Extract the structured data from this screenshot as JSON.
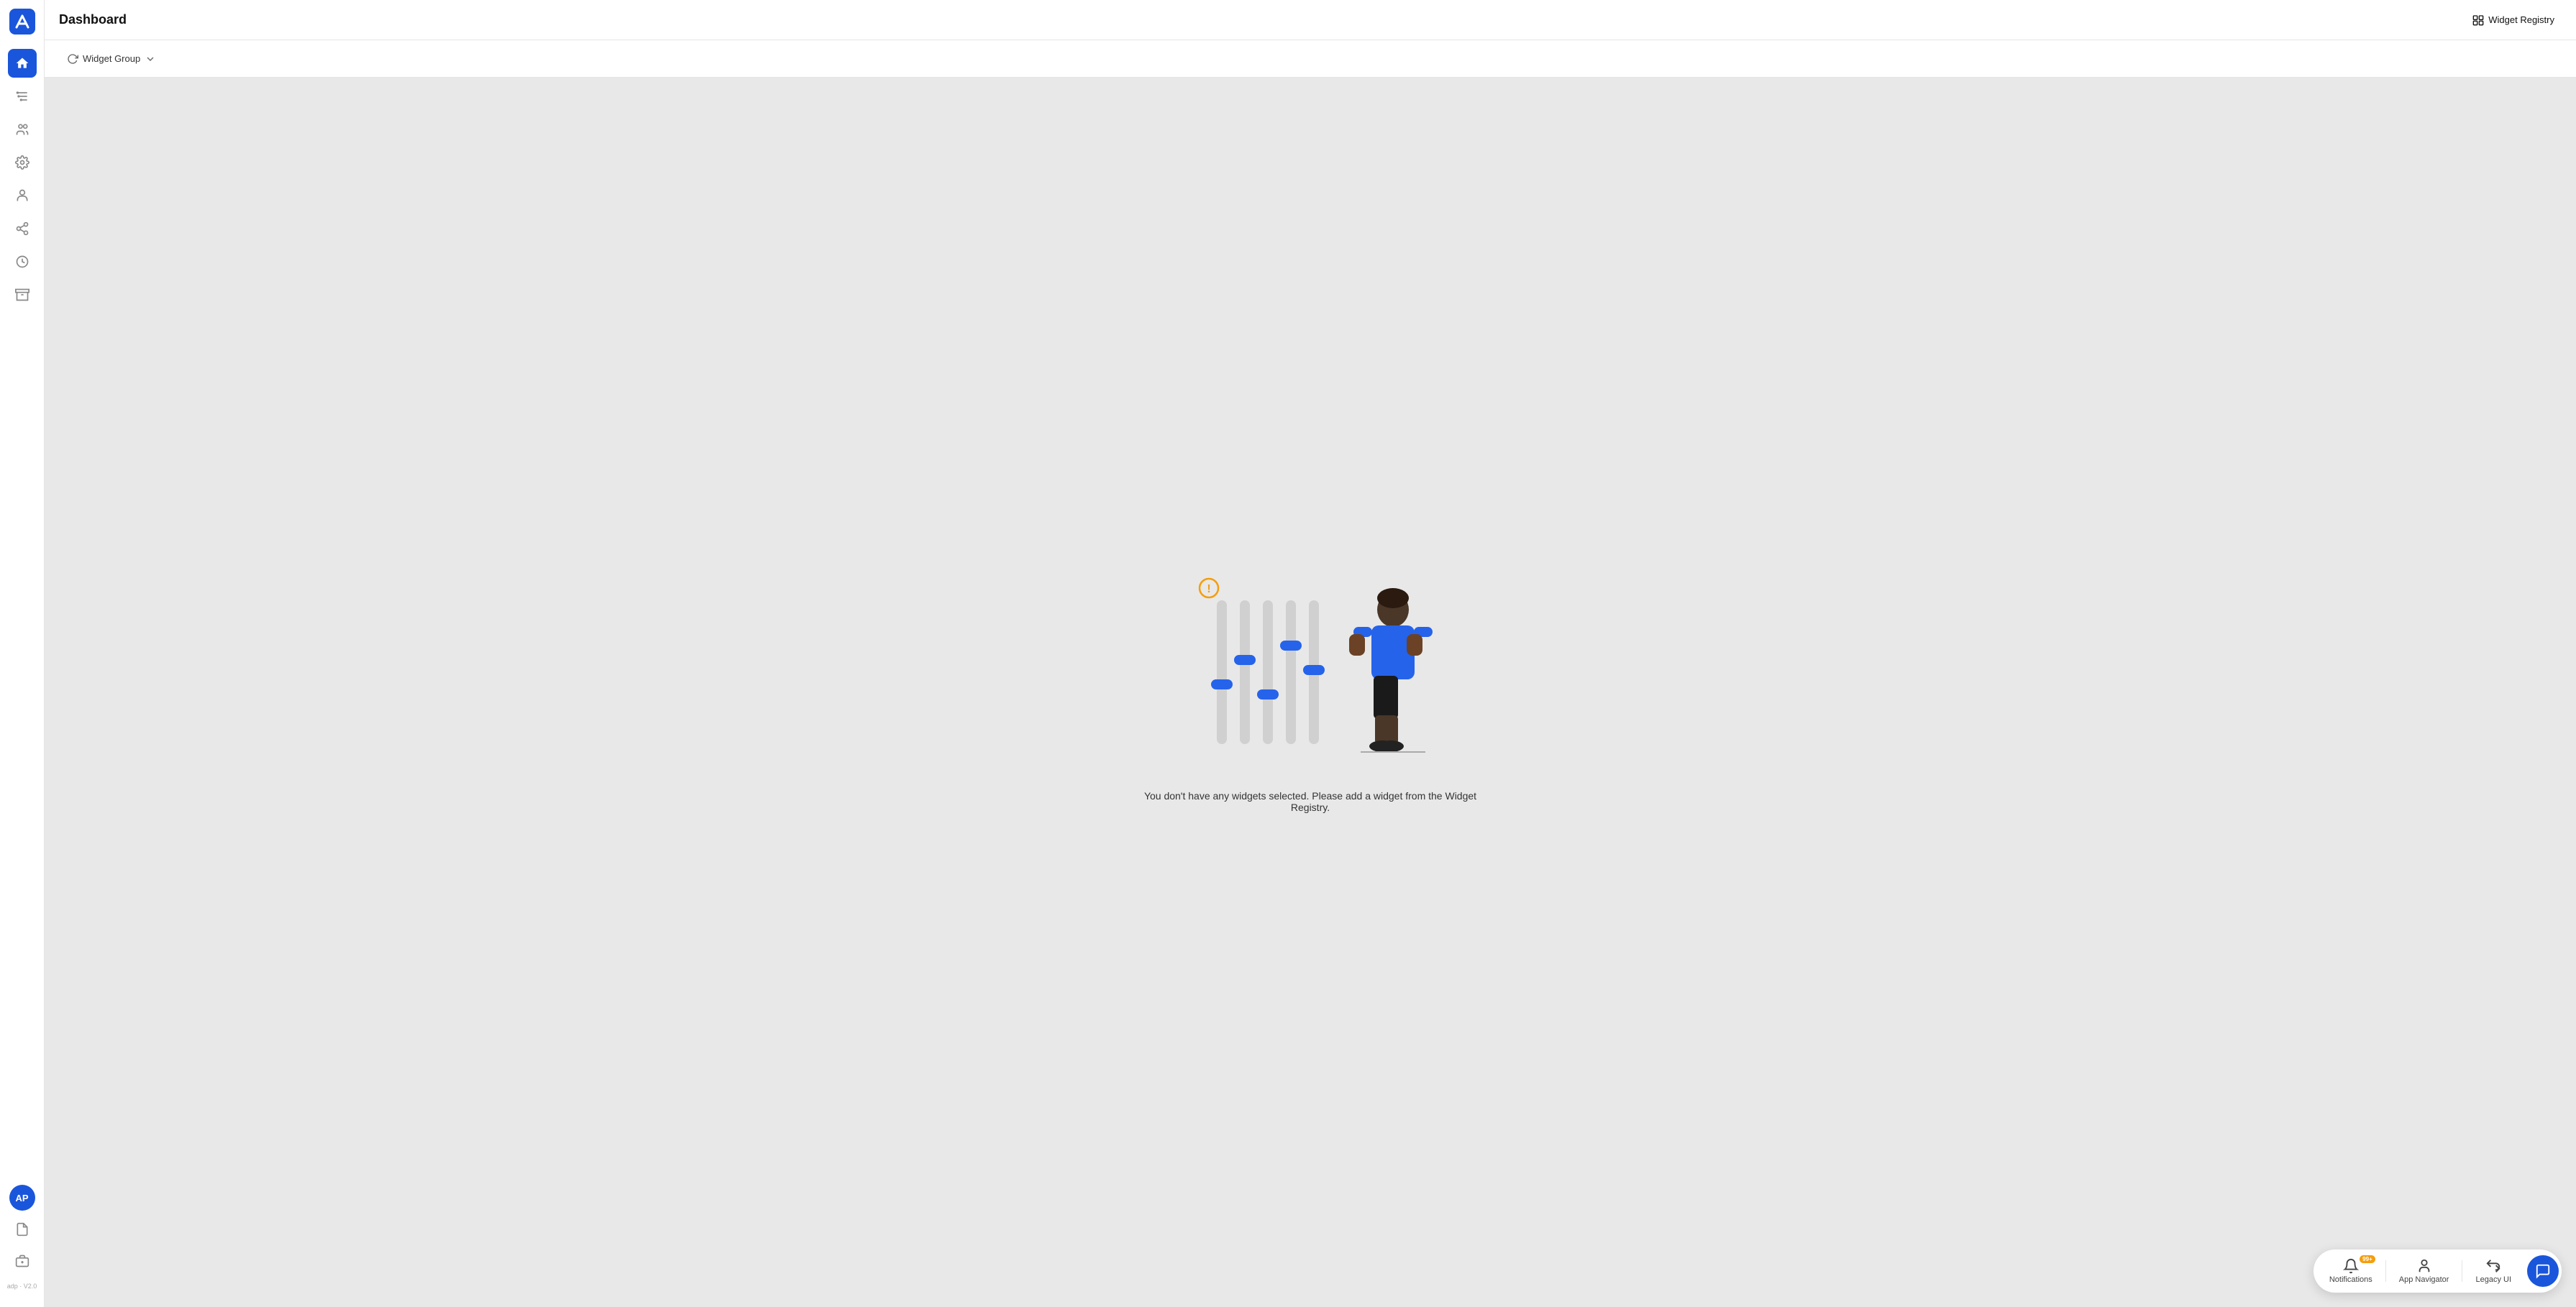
{
  "app": {
    "logo_text": "A",
    "version": "adp · V2.0"
  },
  "header": {
    "title": "Dashboard",
    "widget_registry_label": "Widget Registry"
  },
  "toolbar": {
    "widget_group_label": "Widget Group",
    "chevron_icon": "▾"
  },
  "sidebar": {
    "items": [
      {
        "id": "home",
        "label": "Home",
        "active": true
      },
      {
        "id": "filter",
        "label": "Filter"
      },
      {
        "id": "users",
        "label": "Users"
      },
      {
        "id": "settings",
        "label": "Settings"
      },
      {
        "id": "person",
        "label": "Person"
      },
      {
        "id": "share",
        "label": "Share"
      },
      {
        "id": "history",
        "label": "History"
      },
      {
        "id": "archive",
        "label": "Archive"
      }
    ],
    "bottom": [
      {
        "id": "doc",
        "label": "Document"
      },
      {
        "id": "badge",
        "label": "Badge"
      }
    ],
    "avatar_initials": "AP"
  },
  "empty_state": {
    "message": "You don't have any widgets selected. Please add a widget from the Widget Registry."
  },
  "bottom_bar": {
    "notifications": {
      "label": "Notifications",
      "badge": "99+"
    },
    "app_navigator": {
      "label": "App Navigator"
    },
    "legacy_ui": {
      "label": "Legacy UI"
    }
  }
}
